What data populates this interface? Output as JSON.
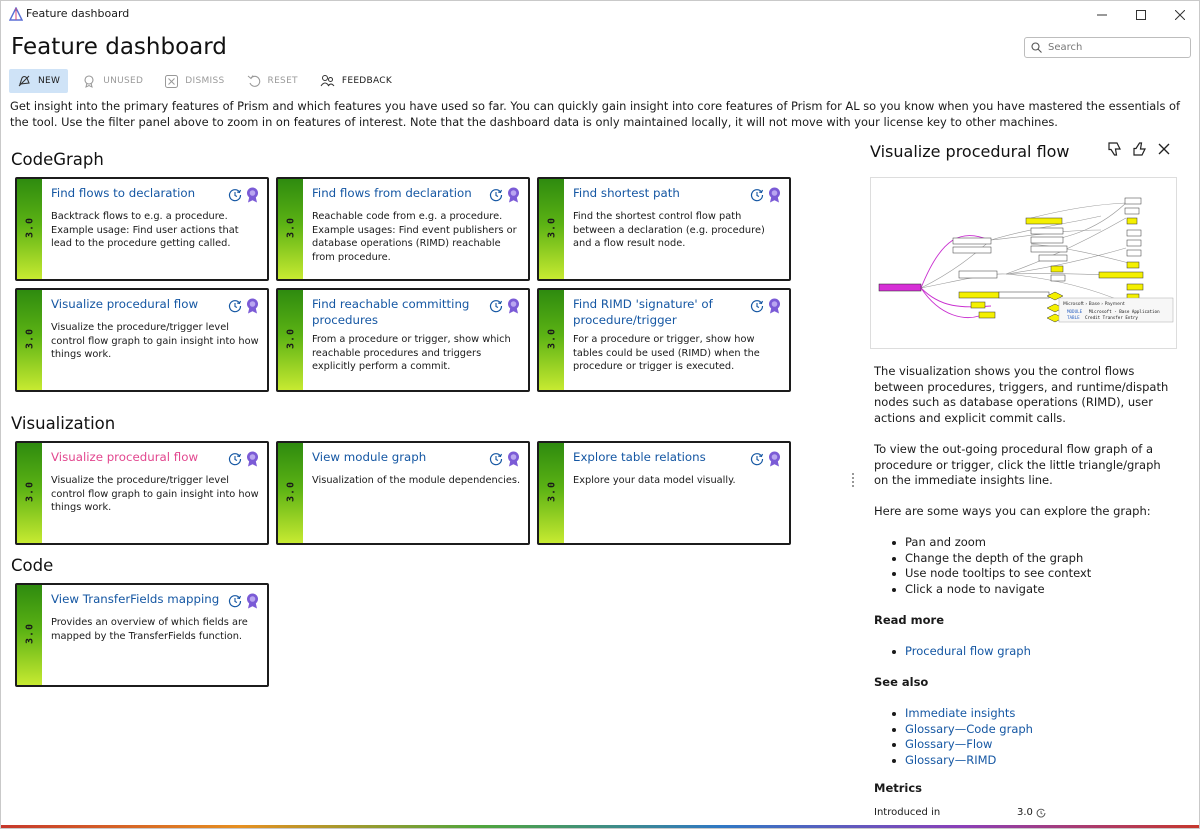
{
  "window": {
    "title": "Feature dashboard"
  },
  "page": {
    "title": "Feature dashboard"
  },
  "search": {
    "placeholder": "Search"
  },
  "toolbar": {
    "items": [
      {
        "label": "NEW",
        "icon": "new-bell-icon",
        "active": true
      },
      {
        "label": "UNUSED",
        "icon": "unused-badge-icon",
        "active": false
      },
      {
        "label": "DISMISS",
        "icon": "dismiss-x-icon",
        "active": false
      },
      {
        "label": "RESET",
        "icon": "reset-undo-icon",
        "active": false
      },
      {
        "label": "FEEDBACK",
        "icon": "feedback-people-icon",
        "active": false
      }
    ]
  },
  "intro": "Get insight into the primary features of Prism and which features you have used so far. You can quickly gain insight into core features of Prism for AL so you know when you have mastered the essentials of the tool. Use the filter panel above to zoom in on features of interest. Note that the dashboard data is only maintained locally, it will not move with your license key to other machines.",
  "sections": [
    {
      "title": "CodeGraph",
      "cards": [
        {
          "version": "3.0",
          "title": "Find flows to declaration",
          "description": "Backtrack flows to e.g. a procedure. Example usage: Find user actions that lead to the procedure getting called."
        },
        {
          "version": "3.0",
          "title": "Find flows from declaration",
          "description": "Reachable code from e.g. a procedure. Example usages: Find event publishers or database operations (RIMD) reachable from procedure."
        },
        {
          "version": "3.0",
          "title": "Find shortest path",
          "description": "Find the shortest control flow path between a declaration (e.g. procedure) and a flow result node."
        },
        {
          "version": "3.0",
          "title": "Visualize procedural flow",
          "description": "Visualize the procedure/trigger level control flow graph to gain insight into how things work."
        },
        {
          "version": "3.0",
          "title": "Find reachable committing procedures",
          "description": "From a procedure or trigger, show which reachable procedures and triggers explicitly perform a commit."
        },
        {
          "version": "3.0",
          "title": "Find RIMD 'signature' of procedure/trigger",
          "description": "For a procedure or trigger, show how tables could be used (RIMD) when the procedure or trigger is executed."
        }
      ]
    },
    {
      "title": "Visualization",
      "cards": [
        {
          "version": "3.0",
          "title": "Visualize procedural flow",
          "description": "Visualize the procedure/trigger level control flow graph to gain insight into how things work.",
          "selected": true
        },
        {
          "version": "3.0",
          "title": "View module graph",
          "description": "Visualization of the module dependencies."
        },
        {
          "version": "3.0",
          "title": "Explore table relations",
          "description": "Explore your data model visually."
        }
      ]
    },
    {
      "title": "Code",
      "cards": [
        {
          "version": "3.0",
          "title": "View TransferFields mapping",
          "description": "Provides an overview of which fields are mapped by the TransferFields function."
        }
      ]
    }
  ],
  "detail": {
    "title": "Visualize procedural flow",
    "paragraph1": "The visualization shows you the control flows between procedures, triggers, and runtime/dispath nodes such as database operations (RIMD), user actions and explicit commit calls.",
    "paragraph2": "To view the out-going procedural flow graph of a procedure or trigger, click the little triangle/graph on the immediate insights line.",
    "paragraph3": "Here are some ways you can explore the graph:",
    "tips": [
      "Pan and zoom",
      "Change the depth of the graph",
      "Use node tooltips to see context",
      "Click a node to navigate"
    ],
    "read_more_heading": "Read more",
    "read_more": [
      "Procedural flow graph"
    ],
    "see_also_heading": "See also",
    "see_also": [
      "Immediate insights",
      "Glossary—Code graph",
      "Glossary—Flow",
      "Glossary—RIMD"
    ],
    "metrics_heading": "Metrics",
    "introduced_label": "Introduced in",
    "introduced_value": "3.0",
    "preview_tooltip": {
      "breadcrumb": "Microsoft › Base › Payment",
      "line1_kw": "MODULE",
      "line1": "Microsoft - Base Application",
      "line2_kw": "TABLE",
      "line2": "Credit Transfer Entry"
    }
  },
  "colors": {
    "accent": "#1557a3",
    "selected_title": "#e2478f",
    "toolbar_active": "#cfe3f7",
    "badge_purple": "#7b5bd6"
  }
}
